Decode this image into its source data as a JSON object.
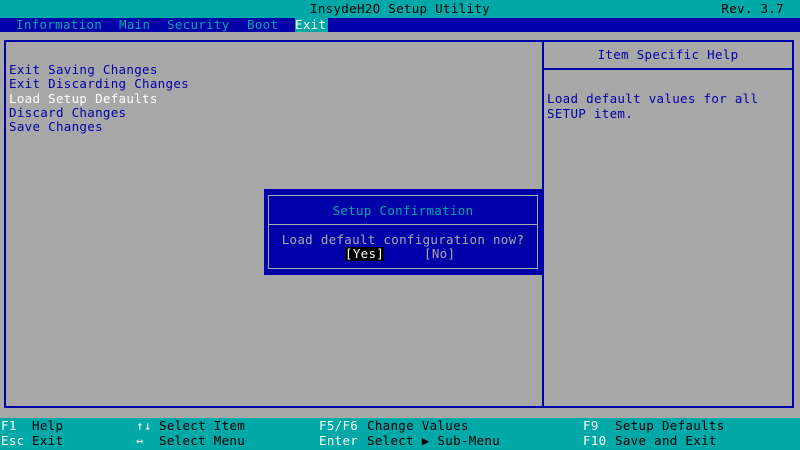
{
  "title_bar": {
    "title": "InsydeH2O Setup Utility",
    "revision": "Rev. 3.7"
  },
  "menu": {
    "tabs": [
      {
        "label": "Information"
      },
      {
        "label": "Main"
      },
      {
        "label": "Security"
      },
      {
        "label": "Boot"
      },
      {
        "label": "Exit"
      }
    ],
    "active": "Exit"
  },
  "options": [
    {
      "label": "Exit Saving Changes"
    },
    {
      "label": "Exit Discarding Changes"
    },
    {
      "label": "Load Setup Defaults"
    },
    {
      "label": "Discard Changes"
    },
    {
      "label": "Save Changes"
    }
  ],
  "selected_option": "Load Setup Defaults",
  "help": {
    "header": "Item Specific Help",
    "text": "Load default values for all\nSETUP item."
  },
  "dialog": {
    "title": "Setup Confirmation",
    "message": "Load default configuration now?",
    "yes_label": "[Yes]",
    "no_label": "[No]"
  },
  "footer": {
    "keys": [
      {
        "key": "F1",
        "desc": "Help"
      },
      {
        "key": "Esc",
        "desc": "Exit"
      },
      {
        "key": "↑↓",
        "desc": "Select Item"
      },
      {
        "key": "↔",
        "desc": "Select Menu"
      },
      {
        "key": "F5/F6",
        "desc": "Change Values"
      },
      {
        "key": "Enter",
        "desc": "Select ▶ Sub-Menu"
      },
      {
        "key": "F9",
        "desc": "Setup Defaults"
      },
      {
        "key": "F10",
        "desc": "Save and Exit"
      }
    ]
  },
  "colors": {
    "background": "#a8a8a8",
    "bios_blue": "#0000a8",
    "cyan": "#00a8a8",
    "highlight": "#ffffff"
  }
}
